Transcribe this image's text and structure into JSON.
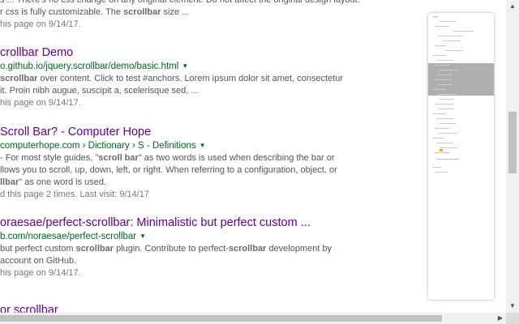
{
  "results": [
    {
      "snippet": [
        [
          "s ... There's no css change on any original element. Do not affect the original design layout."
        ],
        [
          "r css is fully customizable. The ",
          {
            "b": "scrollbar"
          },
          " size ..."
        ]
      ],
      "visited": "his page on 9/14/17."
    },
    {
      "title": "crollbar Demo",
      "url": "o.github.io/jquery.scrollbar/demo/basic.html",
      "snippet": [
        [
          {
            "b": "scrollbar"
          },
          " over content. Click to test #anchors. Lorem ipsum dolor sit amet, consectetur"
        ],
        [
          "it. Proin nibh augue, suscipit a, scelerisque sed, ..."
        ]
      ],
      "visited": "his page on 9/14/17."
    },
    {
      "title": " Scroll Bar? - Computer Hope",
      "url": "computerhope.com › Dictionary › S - Definitions",
      "snippet": [
        [
          "- For most style guides, \"",
          {
            "b": "scroll bar"
          },
          "\" as two words is used when describing the bar or"
        ],
        [
          "llows you to scroll, up, down, left, or right. When referring to a configuration, object, or"
        ],
        [
          {
            "b": "llbar"
          },
          "\" as one word is used."
        ]
      ],
      "visited": "d this page 2 times. Last visit: 9/14/17"
    },
    {
      "title": "oraesae/perfect-scrollbar: Minimalistic but perfect custom ...",
      "url": "b.com/noraesae/perfect-scrollbar",
      "snippet": [
        [
          "but perfect custom ",
          {
            "b": "scrollbar"
          },
          " plugin. Contribute to perfect-",
          {
            "b": "scrollbar"
          },
          " development by"
        ],
        [
          "account on GitHub."
        ]
      ],
      "visited": "his page on 9/14/17."
    },
    {
      "title": "or scrollbar"
    }
  ],
  "scrollbar": {
    "up_arrow": "▲",
    "down_arrow": "▼",
    "right_arrow": "▶"
  },
  "dropdown_arrow": "▼",
  "colors": {
    "title": "#660099",
    "url": "#006621",
    "snippet": "#545454"
  }
}
